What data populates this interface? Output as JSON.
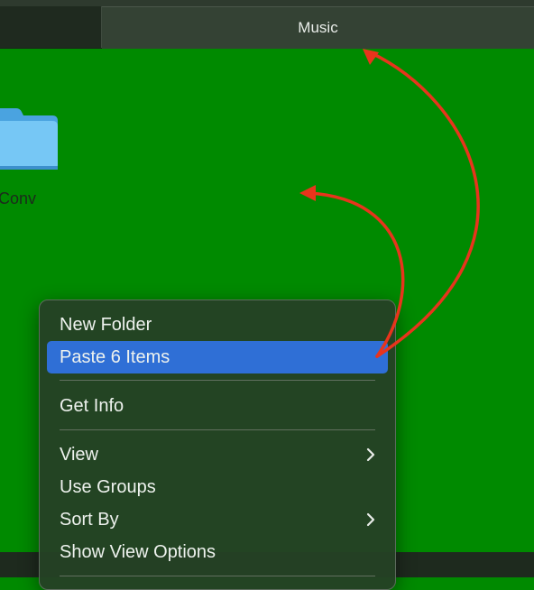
{
  "tabs": {
    "left_label": "",
    "active_label": "Music"
  },
  "desktop": {
    "folder_label": "Conv"
  },
  "context_menu": {
    "items": [
      {
        "label": "New Folder"
      },
      {
        "label": "Paste 6 Items"
      },
      {
        "label": "Get Info"
      },
      {
        "label": "View"
      },
      {
        "label": "Use Groups"
      },
      {
        "label": "Sort By"
      },
      {
        "label": "Show View Options"
      }
    ]
  },
  "colors": {
    "desktop_background": "#008a00",
    "selection": "#2f6fd6",
    "annotation_arrow": "#e8341c",
    "folder": "#6ec1f2"
  }
}
